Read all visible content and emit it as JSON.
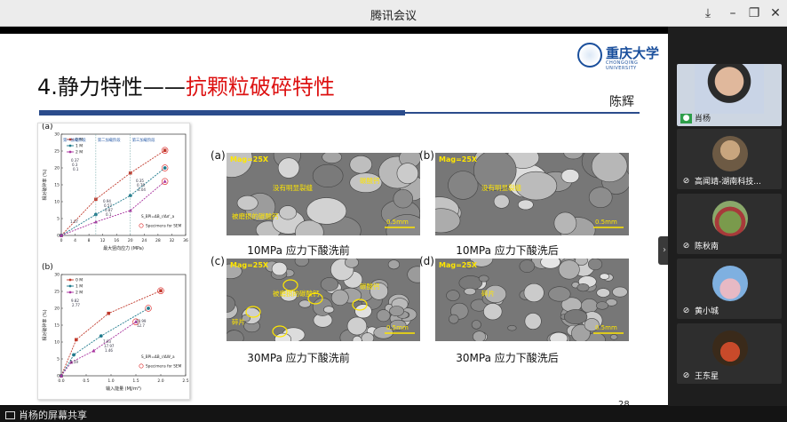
{
  "window": {
    "title": "腾讯会议"
  },
  "slide": {
    "title_prefix": "4.静力特性——",
    "title_highlight": "抗颗粒破碎特性",
    "author": "陈辉",
    "logo_name": "重庆大学",
    "logo_eng": "CHONGQING UNIVERSITY",
    "page_number": "28",
    "plot_a": {
      "label": "(a)",
      "stage_labels": [
        "第一加载阶段",
        "第二加载阶段",
        "第三加载阶段"
      ],
      "legend": [
        "0 M",
        "1 M",
        "2 M"
      ],
      "formula": "S_BPI=ΔB_r/Δσ'_a",
      "specimens": "Specimens for SEM",
      "xlabel": "最大竖向应力 (MPa)",
      "ylabel": "相对破碎率 (%)",
      "xticks": [
        "0",
        "4",
        "8",
        "12",
        "16",
        "20",
        "24",
        "28",
        "32",
        "36"
      ],
      "yticks": [
        "0",
        "5",
        "10",
        "15",
        "20",
        "25",
        "30"
      ],
      "annotations": [
        "1.07",
        "0.94",
        "0.35",
        "0.37",
        "0.57",
        "0.78",
        "0.3",
        "0.87",
        "1.04",
        "0.1",
        "0.1"
      ]
    },
    "plot_b": {
      "label": "(b)",
      "legend": [
        "0 M",
        "1 M",
        "2 M"
      ],
      "formula": "S_BPI=ΔB_r/ΔW_a",
      "specimens": "Specimens for SEM",
      "xlabel": "输入能量 (MJ/m³)",
      "ylabel": "相对破碎率 (%)",
      "xticks": [
        "0.0",
        "0.5",
        "1.0",
        "1.5",
        "2.0",
        "2.5"
      ],
      "yticks": [
        "0",
        "5",
        "10",
        "15",
        "20",
        "25",
        "30"
      ],
      "annotations": [
        "5.59",
        "7.93",
        "10.99",
        "9.82",
        "17.97",
        "12.7",
        "2.77",
        "1.46"
      ]
    },
    "sem_images": [
      {
        "label": "(a)",
        "mag": "Mag=25X",
        "notes": [
          "没有明显裂缝",
          "碳酸钙",
          "被磨损的碳酸钙"
        ],
        "scale": "0.5mm",
        "caption": "10MPa 应力下酸洗前"
      },
      {
        "label": "(b)",
        "mag": "Mag=25X",
        "notes": [
          "没有明显裂缝"
        ],
        "scale": "0.5mm",
        "caption": "10MPa 应力下酸洗后"
      },
      {
        "label": "(c)",
        "mag": "Mag=25X",
        "notes": [
          "被磨损的碳酸钙",
          "碳酸钙",
          "碎片"
        ],
        "scale": "0.5mm",
        "caption": "30MPa 应力下酸洗前"
      },
      {
        "label": "(d)",
        "mag": "Mag=25X",
        "notes": [
          "碎片"
        ],
        "scale": "0.5mm",
        "caption": "30MPa 应力下酸洗后"
      }
    ]
  },
  "chart_data": [
    {
      "type": "line",
      "xlabel": "最大竖向应力 (MPa)",
      "ylabel": "相对破碎率 (%)",
      "xlim": [
        0,
        36
      ],
      "ylim": [
        0,
        30
      ],
      "x": [
        0,
        10,
        20,
        30
      ],
      "series": [
        {
          "name": "0 M",
          "values": [
            0,
            10.7,
            18.5,
            25.2
          ]
        },
        {
          "name": "1 M",
          "values": [
            0,
            6.2,
            11.8,
            20.0
          ]
        },
        {
          "name": "2 M",
          "values": [
            0,
            4.0,
            7.4,
            16.0
          ]
        }
      ]
    },
    {
      "type": "line",
      "xlabel": "输入能量 (MJ/m³)",
      "ylabel": "相对破碎率 (%)",
      "xlim": [
        0,
        2.5
      ],
      "ylim": [
        0,
        30
      ],
      "series": [
        {
          "name": "0 M",
          "x": [
            0,
            0.3,
            0.95,
            2.0
          ],
          "values": [
            0,
            10.7,
            18.5,
            25.2
          ]
        },
        {
          "name": "1 M",
          "x": [
            0,
            0.25,
            0.8,
            1.75
          ],
          "values": [
            0,
            6.2,
            11.8,
            20.0
          ]
        },
        {
          "name": "2 M",
          "x": [
            0,
            0.2,
            0.65,
            1.5
          ],
          "values": [
            0,
            4.0,
            7.4,
            16.0
          ]
        }
      ]
    }
  ],
  "participants": [
    {
      "name": "肖杨",
      "mic": "on"
    },
    {
      "name": "高闻靖-湖南科技...",
      "mic": "muted"
    },
    {
      "name": "陈秋南",
      "mic": "muted"
    },
    {
      "name": "黄小城",
      "mic": "muted"
    },
    {
      "name": "王东星",
      "mic": "muted"
    }
  ],
  "bottom": {
    "sharing_text": "肖杨的屏幕共享"
  },
  "colors": {
    "series_0": "#c0392b",
    "series_1": "#1f7a8c",
    "series_2": "#a8329e",
    "rule": "#2b4c8c"
  }
}
